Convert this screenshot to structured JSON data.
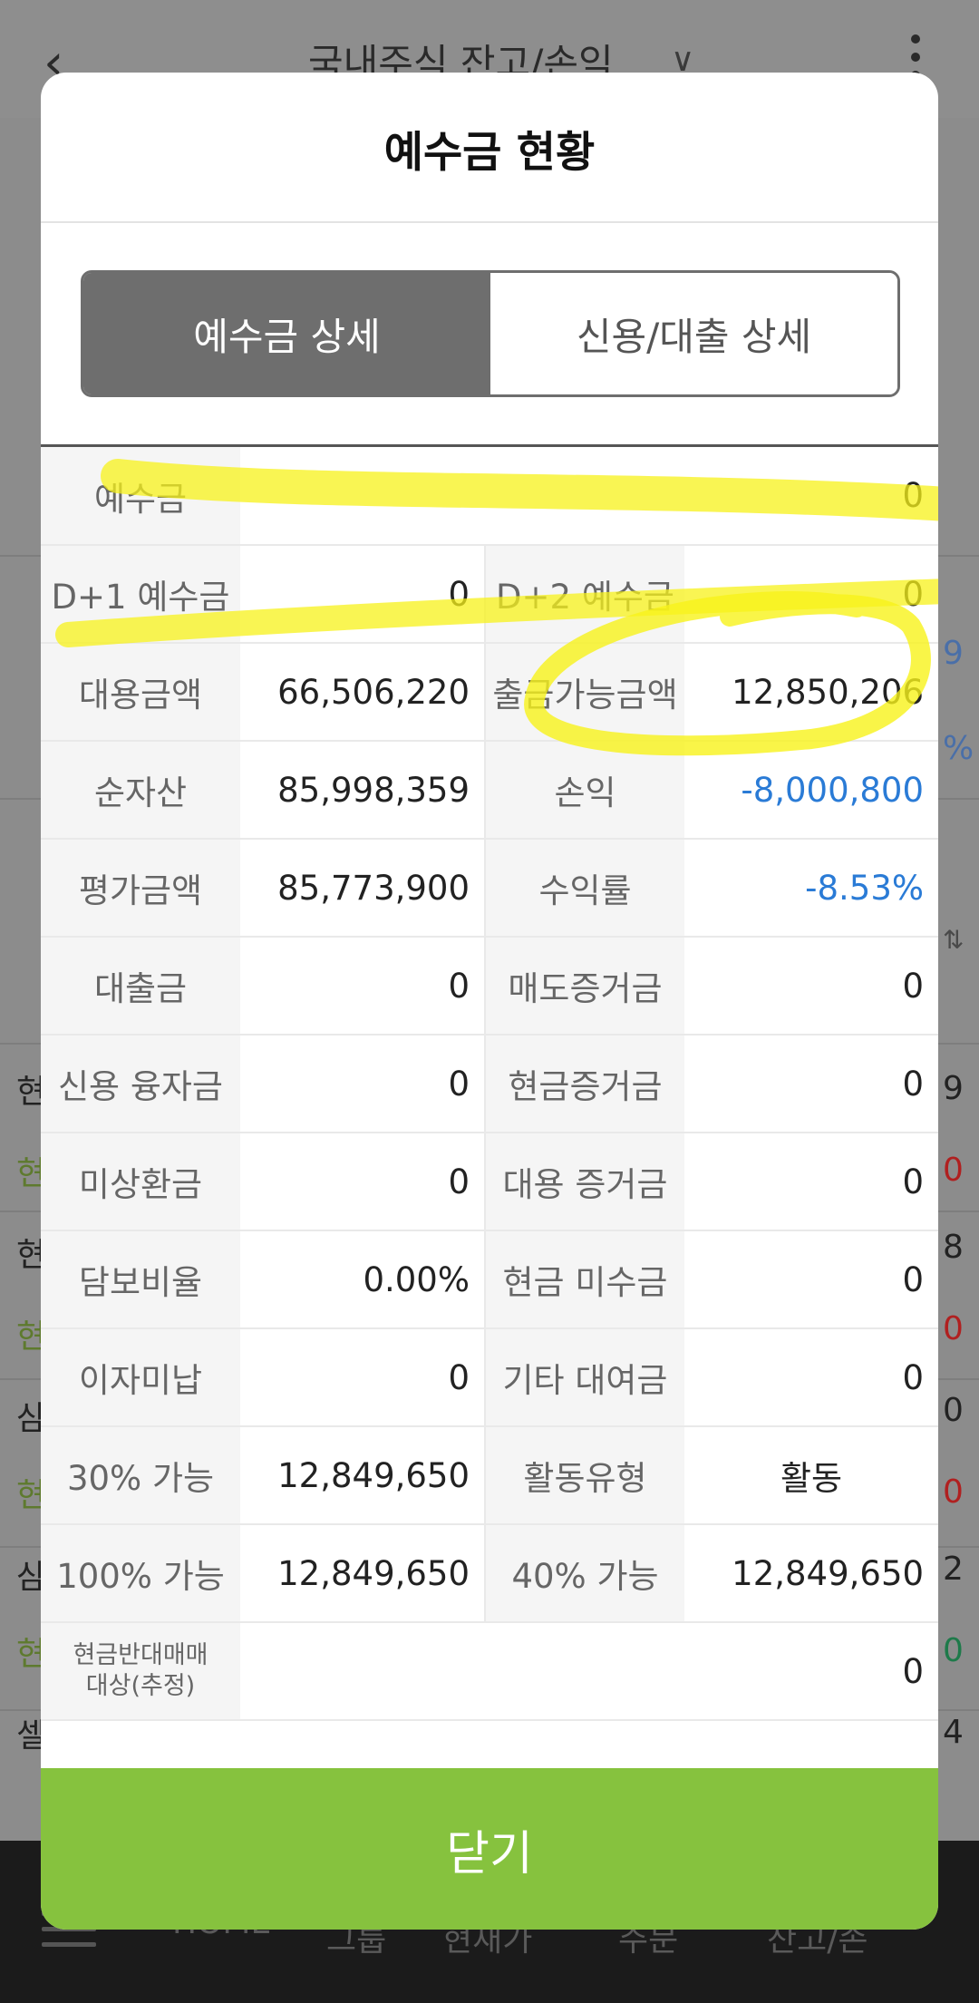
{
  "background": {
    "title": "국내주식 잔고/손익",
    "nav": [
      "HOME",
      "그룹",
      "현재가",
      "주문",
      "잔고/손"
    ],
    "edge_values": [
      {
        "text": "9",
        "color": "#4a6fa8"
      },
      {
        "text": "%",
        "color": "#4a6fa8"
      },
      {
        "text": "9",
        "color": "#222222"
      },
      {
        "text": "0",
        "color": "#b02020"
      },
      {
        "text": "8",
        "color": "#222222"
      },
      {
        "text": "0",
        "color": "#b02020"
      },
      {
        "text": "0",
        "color": "#222222"
      },
      {
        "text": "0",
        "color": "#b02020"
      },
      {
        "text": "2",
        "color": "#222222"
      },
      {
        "text": "0",
        "color": "#1e7a4a"
      },
      {
        "text": "4",
        "color": "#222222"
      }
    ],
    "left_edge": [
      "현",
      "현",
      "현",
      "현",
      "삼",
      "현",
      "삼",
      "현",
      "셀"
    ]
  },
  "modal": {
    "title": "예수금 현황",
    "tabs": [
      {
        "label": "예수금 상세",
        "active": true
      },
      {
        "label": "신용/대출 상세",
        "active": false
      }
    ],
    "deposit": {
      "label": "예수금",
      "value": "0"
    },
    "rows": [
      {
        "l1": "D+1 예수금",
        "v1": "0",
        "l2": "D+2 예수금",
        "v2": "0"
      },
      {
        "l1": "대용금액",
        "v1": "66,506,220",
        "l2": "출금가능금액",
        "v2": "12,850,206"
      },
      {
        "l1": "순자산",
        "v1": "85,998,359",
        "l2": "손익",
        "v2": "-8,000,800"
      },
      {
        "l1": "평가금액",
        "v1": "85,773,900",
        "l2": "수익률",
        "v2": "-8.53%"
      },
      {
        "l1": "대출금",
        "v1": "0",
        "l2": "매도증거금",
        "v2": "0"
      },
      {
        "l1": "신용 융자금",
        "v1": "0",
        "l2": "현금증거금",
        "v2": "0"
      },
      {
        "l1": "미상환금",
        "v1": "0",
        "l2": "대용 증거금",
        "v2": "0"
      },
      {
        "l1": "담보비율",
        "v1": "0.00%",
        "l2": "현금 미수금",
        "v2": "0"
      },
      {
        "l1": "이자미납",
        "v1": "0",
        "l2": "기타 대여금",
        "v2": "0"
      },
      {
        "l1": "30% 가능",
        "v1": "12,849,650",
        "l2": "활동유형",
        "v2": "활동"
      },
      {
        "l1": "100% 가능",
        "v1": "12,849,650",
        "l2": "40% 가능",
        "v2": "12,849,650"
      }
    ],
    "last_row": {
      "label_line1": "현금반대매매",
      "label_line2": "대상(추정)",
      "value": "0"
    },
    "close_label": "닫기"
  },
  "colors": {
    "accent_green": "#86c23e",
    "tab_active": "#6e6e6e",
    "negative_blue": "#2a7bd6",
    "highlighter": "#f7f21a"
  }
}
